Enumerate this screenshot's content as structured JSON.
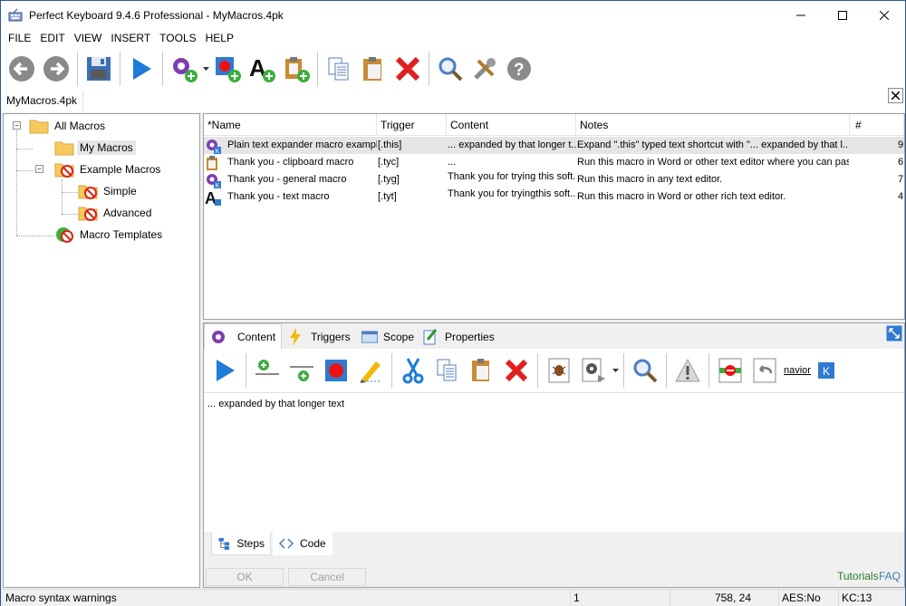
{
  "window": {
    "title": "Perfect Keyboard 9.4.6 Professional - MyMacros.4pk"
  },
  "menu": [
    "FILE",
    "EDIT",
    "VIEW",
    "INSERT",
    "TOOLS",
    "HELP"
  ],
  "toolbar": {
    "icons": [
      "back-icon",
      "forward-icon",
      "save-icon",
      "play-icon",
      "new-macro-icon",
      "new-recorded-macro-icon",
      "new-text-macro-icon",
      "new-clipboard-macro-icon",
      "copy-icon",
      "paste-icon",
      "delete-icon",
      "search-icon",
      "tools-icon",
      "help-icon"
    ]
  },
  "document_tab": "MyMacros.4pk",
  "tree": {
    "nodes": [
      {
        "label": "All Macros"
      },
      {
        "label": "My Macros"
      },
      {
        "label": "Example Macros"
      },
      {
        "label": "Simple"
      },
      {
        "label": "Advanced"
      },
      {
        "label": "Macro Templates"
      }
    ]
  },
  "list": {
    "columns": [
      "*Name",
      "Trigger",
      "Content",
      "Notes",
      "#"
    ],
    "rows": [
      {
        "name": "Plain text expander macro example",
        "trigger": "[.this]",
        "content": "... expanded by that longer t...",
        "notes": "Expand \".this\" typed text shortcut with \"... expanded by that l...",
        "count": "9",
        "icon": "gear-macro-icon"
      },
      {
        "name": "Thank you - clipboard macro",
        "trigger": "[.tyc]",
        "content": "...",
        "notes": "Run this macro in Word or other text editor where you can pas...",
        "count": "6",
        "icon": "clipboard-macro-icon"
      },
      {
        "name": "Thank you - general macro",
        "trigger": "[.tyg]",
        "content": "Thank you for trying this soft...",
        "notes": "Run this macro in any text editor.",
        "count": "7",
        "icon": "gear-macro-icon"
      },
      {
        "name": "Thank you - text macro",
        "trigger": "[.tyt]",
        "content": "Thank you for tryingthis soft...",
        "notes": "Run this macro in Word or other rich text editor.",
        "count": "4",
        "icon": "text-macro-icon"
      }
    ]
  },
  "content_tabs": [
    "Content",
    "Triggers",
    "Scope",
    "Properties"
  ],
  "content_toolbar_trailing": "navior",
  "editor": {
    "text": "... expanded by that longer text"
  },
  "sub_tabs": [
    "Steps",
    "Code"
  ],
  "buttons": {
    "ok": "OK",
    "cancel": "Cancel"
  },
  "links": {
    "tutorials": "Tutorials",
    "faq": "FAQ"
  },
  "status": {
    "message": "Macro syntax warnings",
    "line": "1",
    "position": "758,  24",
    "aes": "AES:No",
    "kc": "KC:13"
  },
  "colors": {
    "accent": "#2b5797",
    "play": "#1e7bd8",
    "delete": "#e02020",
    "link_green": "#2a7a2a",
    "link_blue": "#3c7fb1"
  }
}
